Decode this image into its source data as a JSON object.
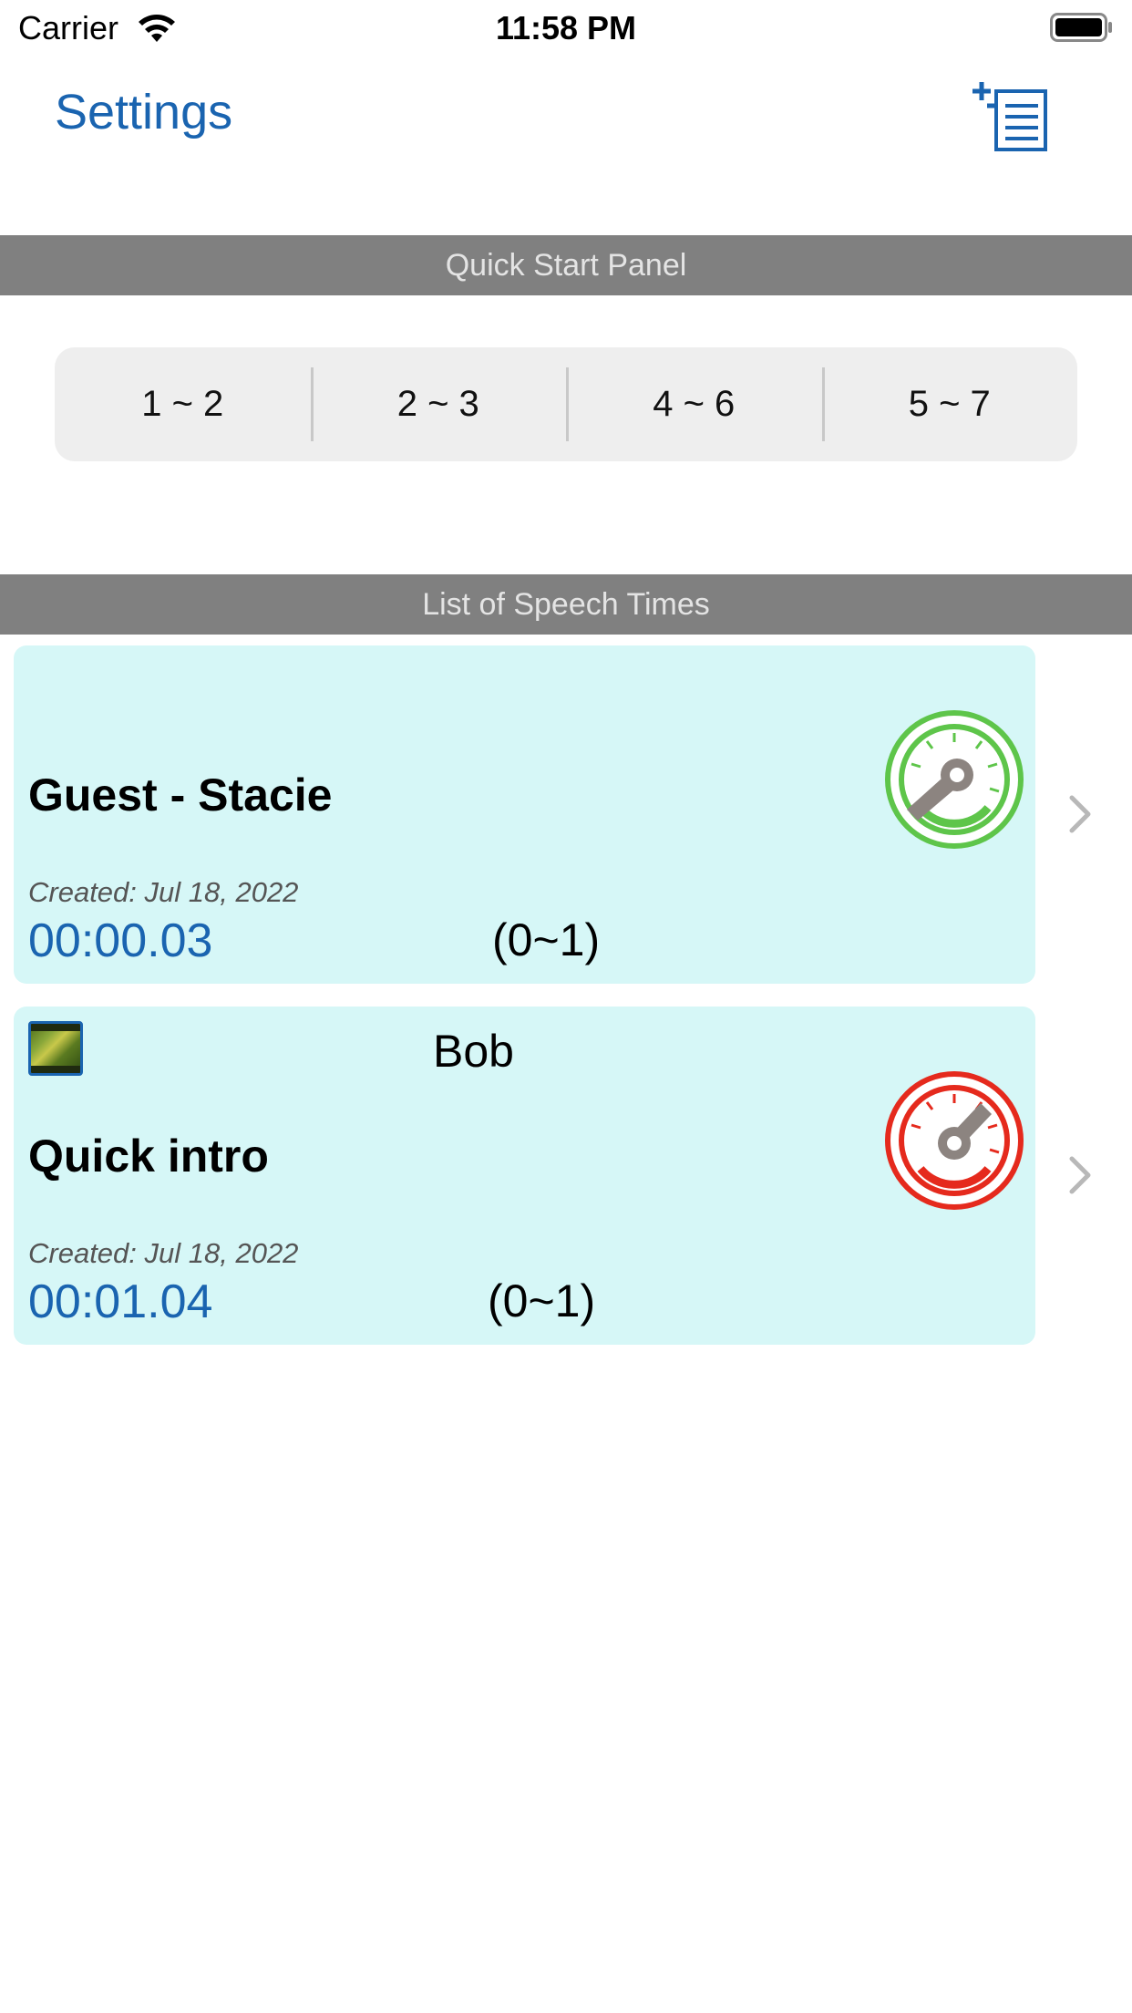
{
  "status_bar": {
    "carrier": "Carrier",
    "time": "11:58 PM",
    "wifi_icon": "wifi-icon",
    "battery_icon": "battery-icon"
  },
  "nav": {
    "settings_label": "Settings",
    "add_icon": "add-document-icon"
  },
  "colors": {
    "accent": "#1a64b0",
    "section_header_bg": "#808080",
    "card_bg": "#d6f7f7",
    "gauge_green": "#5ec54a",
    "gauge_red": "#e52a1d"
  },
  "quick_start": {
    "header": "Quick Start Panel",
    "segments": [
      "1 ~ 2",
      "2 ~ 3",
      "4 ~ 6",
      "5 ~ 7"
    ]
  },
  "speech_list": {
    "header": "List of Speech Times",
    "items": [
      {
        "title": "Guest - Stacie",
        "speaker": "",
        "created": "Created:  Jul 18, 2022",
        "duration": "00:00.03",
        "range": "(0~1)",
        "gauge_icon": "gauge-green-icon",
        "has_thumbnail": false
      },
      {
        "title": "Quick intro",
        "speaker": "Bob",
        "created": "Created:  Jul 18, 2022",
        "duration": "00:01.04",
        "range": "(0~1)",
        "gauge_icon": "gauge-red-icon",
        "has_thumbnail": true
      }
    ]
  }
}
